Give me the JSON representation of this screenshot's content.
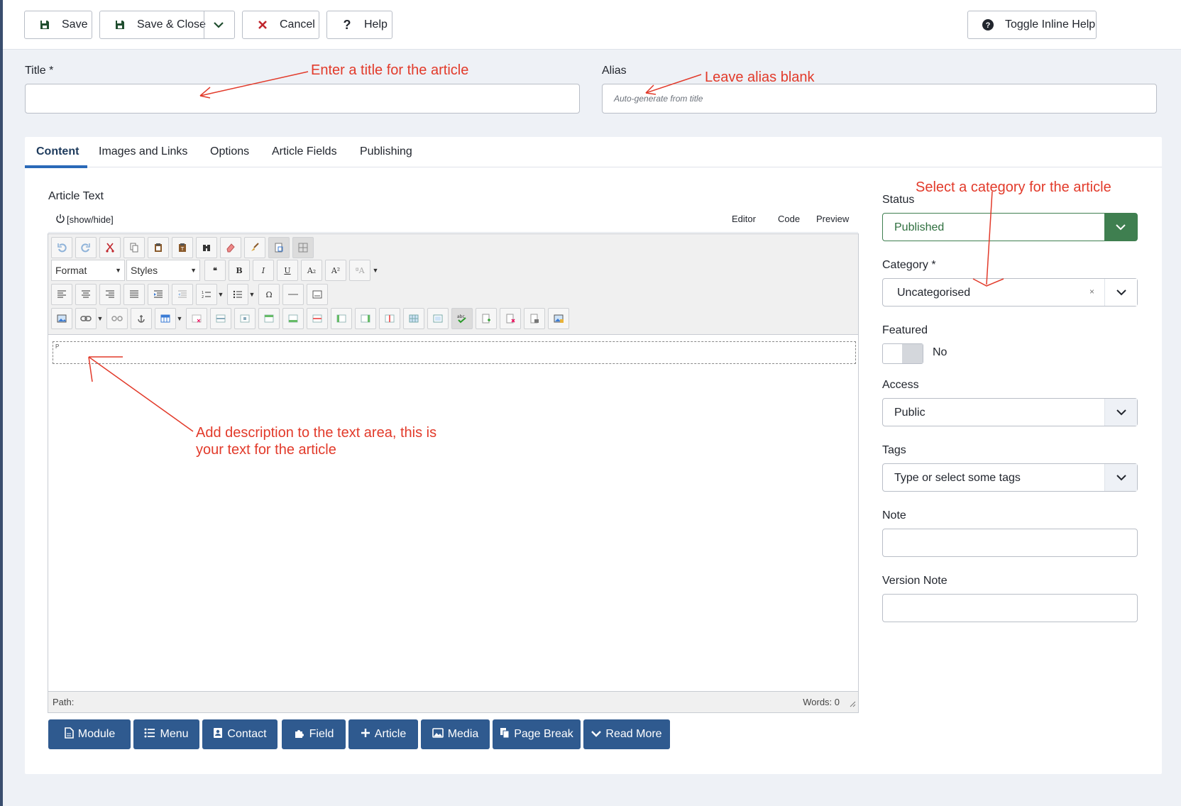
{
  "toolbar": {
    "save": "Save",
    "save_close": "Save & Close",
    "cancel": "Cancel",
    "help": "Help",
    "toggle_help": "Toggle Inline Help"
  },
  "form": {
    "title_label": "Title *",
    "title_value": "",
    "alias_label": "Alias",
    "alias_placeholder": "Auto-generate from title"
  },
  "tabs": [
    {
      "label": "Content",
      "active": true
    },
    {
      "label": "Images and Links"
    },
    {
      "label": "Options"
    },
    {
      "label": "Article Fields"
    },
    {
      "label": "Publishing"
    }
  ],
  "editor": {
    "label": "Article Text",
    "show_hide": "[show/hide]",
    "modes": [
      "Editor",
      "Code",
      "Preview"
    ],
    "format_select": "Format",
    "styles_select": "Styles",
    "paragraph_marker": "P",
    "path_label": "Path:",
    "words_label": "Words: 0"
  },
  "insert_buttons": [
    "Module",
    "Menu",
    "Contact",
    "Field",
    "Article",
    "Media",
    "Page Break",
    "Read More"
  ],
  "sidebar": {
    "status_label": "Status",
    "status_value": "Published",
    "category_label": "Category *",
    "category_value": "Uncategorised",
    "featured_label": "Featured",
    "featured_value": "No",
    "access_label": "Access",
    "access_value": "Public",
    "tags_label": "Tags",
    "tags_placeholder": "Type or select some tags",
    "note_label": "Note",
    "note_value": "",
    "version_note_label": "Version Note",
    "version_note_value": ""
  },
  "annotations": {
    "title": "Enter a title for the article",
    "alias": "Leave alias blank",
    "category": "Select a category for the article",
    "text_line1": "Add description to the text area, this is",
    "text_line2": "your text for the article"
  },
  "colors": {
    "annotation": "#e23a2a",
    "status_green": "#3f7f50",
    "insert_button_blue": "#2f5a8f",
    "active_tab_underline": "#2a69b8"
  }
}
